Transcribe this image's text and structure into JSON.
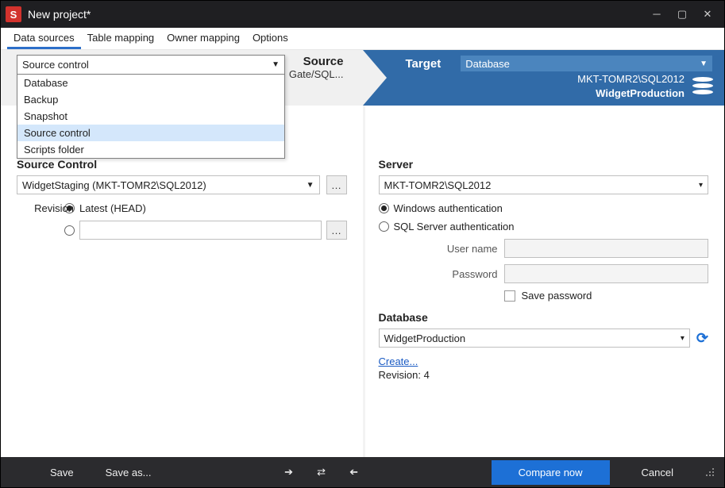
{
  "title": "New project*",
  "tabs": [
    "Data sources",
    "Table mapping",
    "Owner mapping",
    "Options"
  ],
  "active_tab": 0,
  "source": {
    "header": "Source",
    "type_value": "Source control",
    "type_options": [
      "Database",
      "Backup",
      "Snapshot",
      "Source control",
      "Scripts folder"
    ],
    "sub_text": "Gate/SQL...",
    "sc_label": "Source Control",
    "sc_value": "WidgetStaging (MKT-TOMR2\\SQL2012)",
    "rev_label": "Revision",
    "rev_latest": "Latest (HEAD)",
    "rev_other": ""
  },
  "target": {
    "header": "Target",
    "type_value": "Database",
    "server_name": "MKT-TOMR2\\SQL2012",
    "dbname_bold": "WidgetProduction",
    "server_label": "Server",
    "server_value": "MKT-TOMR2\\SQL2012",
    "auth_win": "Windows authentication",
    "auth_sql": "SQL Server authentication",
    "user_label": "User name",
    "pass_label": "Password",
    "savepw_label": "Save password",
    "db_label": "Database",
    "db_value": "WidgetProduction",
    "create_link": "Create...",
    "revision_text": "Revision: 4"
  },
  "footer": {
    "save": "Save",
    "saveas": "Save as...",
    "compare": "Compare now",
    "cancel": "Cancel"
  }
}
